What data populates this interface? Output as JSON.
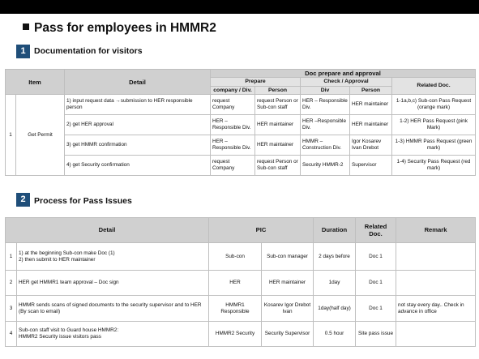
{
  "header": {
    "title": "Pass for employees in HMMR2"
  },
  "section1": {
    "number": "1",
    "title": "Documentation for visitors",
    "headers": {
      "item": "Item",
      "detail": "Detail",
      "doc_prepare_approval": "Doc prepare and approval",
      "prepare": "Prepare",
      "check_approval": "Check / Approval",
      "related_doc": "Related Doc.",
      "company_div": "company / Div.",
      "person": "Person",
      "div": "Div",
      "person2": "Person"
    },
    "item_no": "1",
    "item_name": "Get Permit",
    "rows": [
      {
        "detail": "1) input request data →submission to HER responsible person",
        "prep_company": "request Company",
        "prep_person": "request Person or Sub-con staff",
        "check_div": "HER – Responsible Div.",
        "check_person": "HER maintainer",
        "related": "1-1a,b,c) Sub-con Pass Request (orange mark)"
      },
      {
        "detail": "2) get HER approval",
        "prep_company": "HER –Responsible Div.",
        "prep_person": "HER maintainer",
        "check_div": "HER –Responsible Div.",
        "check_person": "HER maintainer",
        "related": "1-2) HER Pass Request (pink Mark)"
      },
      {
        "detail": "3) get HMMR confirmation",
        "prep_company": "HER –Responsible Div.",
        "prep_person": "HER maintainer",
        "check_div": "HMMR – Construction Div.",
        "check_person": "Igor Kosarev Ivan Drebot",
        "related": "1-3) HMMR Pass Request (green mark)"
      },
      {
        "detail": "4) get Security confirmation",
        "prep_company": "request Company",
        "prep_person": "request Person or Sub-con staff",
        "check_div": "Security HMMR-2",
        "check_person": "Supervisor",
        "related": "1-4) Security Pass Request (red mark)"
      }
    ]
  },
  "section2": {
    "number": "2",
    "title": "Process for Pass Issues",
    "headers": {
      "detail": "Detail",
      "pic": "PIC",
      "duration": "Duration",
      "related_doc": "Related Doc.",
      "remark": "Remark"
    },
    "rows": [
      {
        "no": "1",
        "detail": "1) at the beginning Sub-con make Doc (1)\n2) then submit to HER maintainer",
        "pic1": "Sub-con",
        "pic2": "Sub-con manager",
        "duration": "2 days before",
        "related": "Doc 1",
        "remark": ""
      },
      {
        "no": "2",
        "detail": "HER get HMMR1 team approval – Doc sign",
        "pic1": "HER",
        "pic2": "HER maintainer",
        "duration": "1day",
        "related": "Doc 1",
        "remark": ""
      },
      {
        "no": "3",
        "detail": "HMMR sends scans of signed documents to the security supervisor and to HER (By scan to email)",
        "pic1": "HMMR1 Responsible",
        "pic2": "Kosarev Igor Drebot Ivan",
        "duration": "1day(half day)",
        "related": "Doc 1",
        "remark": "not stay every day.. Check in advance in office"
      },
      {
        "no": "4",
        "detail": "Sub-con staff visit to Guard house HMMR2:\nHMMR2 Security issue visitors pass",
        "pic1": "HMMR2 Security",
        "pic2": "Security Supervisor",
        "duration": "0.5 hour",
        "related": "Site pass issue",
        "remark": ""
      }
    ]
  }
}
